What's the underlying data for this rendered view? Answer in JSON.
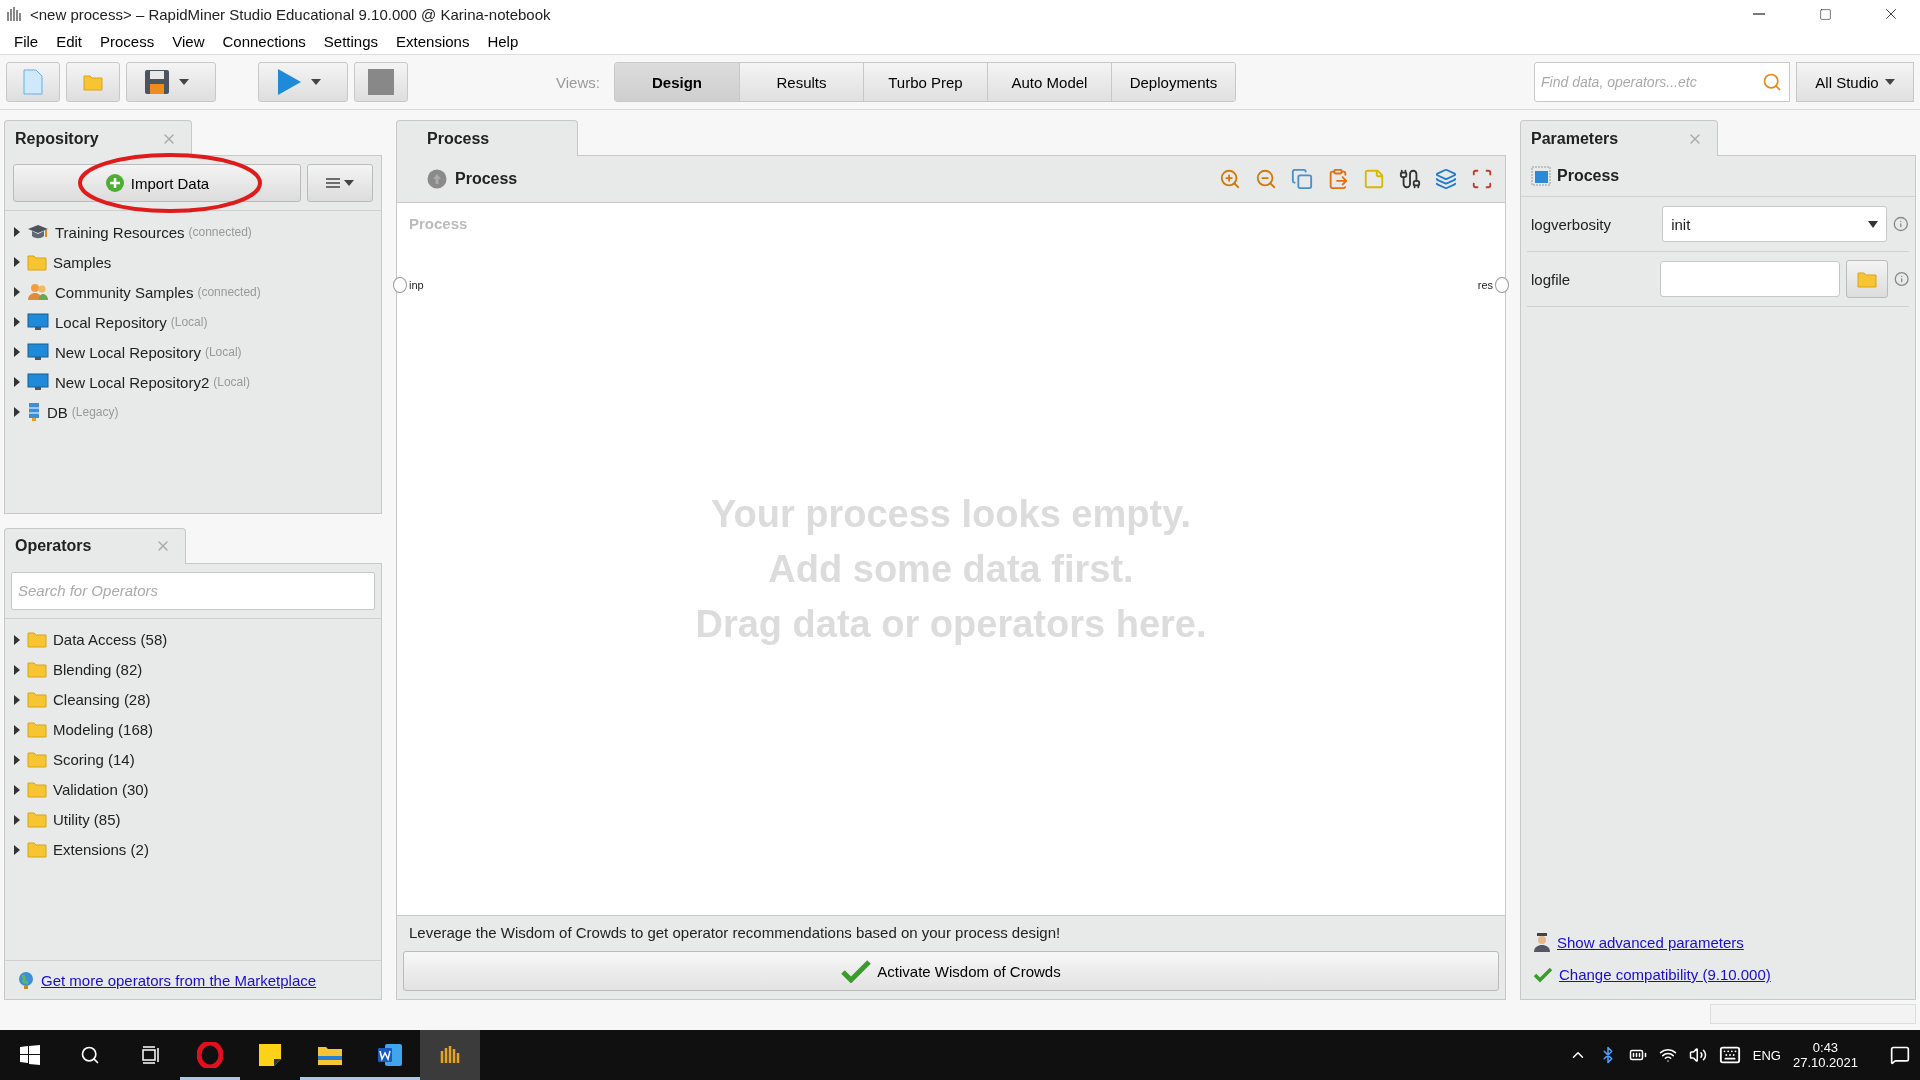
{
  "window": {
    "title": "<new process> – RapidMiner Studio Educational 9.10.000 @ Karina-notebook"
  },
  "menu": [
    "File",
    "Edit",
    "Process",
    "View",
    "Connections",
    "Settings",
    "Extensions",
    "Help"
  ],
  "toolbar": {
    "views_label": "Views:",
    "views": [
      {
        "label": "Design",
        "selected": true
      },
      {
        "label": "Results",
        "selected": false
      },
      {
        "label": "Turbo Prep",
        "selected": false
      },
      {
        "label": "Auto Model",
        "selected": false
      },
      {
        "label": "Deployments",
        "selected": false
      }
    ],
    "search": {
      "placeholder": "Find data, operators...etc"
    },
    "scope": "All Studio"
  },
  "repository": {
    "title": "Repository",
    "import_button": "Import Data",
    "items": [
      {
        "kind": "training",
        "name": "Training Resources",
        "note": "(connected)",
        "expanded": false
      },
      {
        "kind": "folder",
        "name": "Samples",
        "expanded": false
      },
      {
        "kind": "community",
        "name": "Community Samples",
        "note": "(connected)",
        "expanded": false
      },
      {
        "kind": "local",
        "name": "Local Repository",
        "note": "(Local)",
        "expanded": false
      },
      {
        "kind": "local",
        "name": "New Local Repository",
        "note": "(Local)",
        "expanded": false
      },
      {
        "kind": "local",
        "name": "New Local Repository2",
        "note": "(Local)",
        "expanded": false
      },
      {
        "kind": "db",
        "name": "DB",
        "note": "(Legacy)",
        "expanded": false
      }
    ]
  },
  "operators": {
    "title": "Operators",
    "search": {
      "placeholder": "Search for Operators"
    },
    "items": [
      {
        "label": "Data Access (58)",
        "expanded": false
      },
      {
        "label": "Blending (82)",
        "expanded": false
      },
      {
        "label": "Cleansing (28)",
        "expanded": false
      },
      {
        "label": "Modeling (168)",
        "expanded": false
      },
      {
        "label": "Scoring (14)",
        "expanded": false
      },
      {
        "label": "Validation (30)",
        "expanded": false
      },
      {
        "label": "Utility (85)",
        "expanded": false
      },
      {
        "label": "Extensions (2)",
        "expanded": false
      }
    ],
    "marketplace_link": "Get more operators from the Marketplace"
  },
  "process": {
    "title": "Process",
    "breadcrumb": "Process",
    "canvas_label": "Process",
    "input_port": "inp",
    "output_port": "res",
    "empty_message": [
      "Your process looks empty.",
      "Add some data first.",
      "Drag data or operators here."
    ],
    "wisdom_text": "Leverage the Wisdom of Crowds to get operator recommendations based on your process design!",
    "wisdom_button": "Activate Wisdom of Crowds"
  },
  "parameters": {
    "title": "Parameters",
    "operator": "Process",
    "params": [
      {
        "kind": "select",
        "name": "logverbosity",
        "value": "init"
      },
      {
        "kind": "file",
        "name": "logfile"
      }
    ],
    "links": [
      {
        "kind": "advanced",
        "label": "Show advanced parameters"
      },
      {
        "kind": "compat",
        "label": "Change compatibility (9.10.000)"
      }
    ]
  },
  "taskbar": {
    "apps": [
      {
        "kind": "opera",
        "selected": false
      },
      {
        "kind": "notes",
        "selected": false
      },
      {
        "kind": "explorer",
        "selected": false
      },
      {
        "kind": "word",
        "selected": false
      },
      {
        "kind": "rapidminer",
        "selected": true
      }
    ],
    "language": "ENG",
    "time": "0:43",
    "date": "27.10.2021"
  }
}
